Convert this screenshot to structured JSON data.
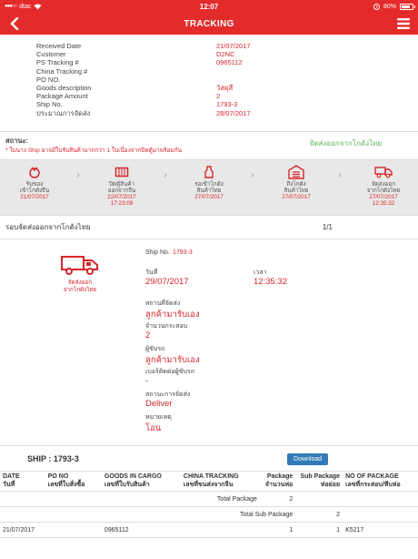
{
  "status_bar": {
    "carrier": "dtac",
    "time": "12:07",
    "battery": "80%",
    "battery_level": 0.8
  },
  "nav": {
    "title": "TRACKING"
  },
  "info": [
    {
      "label": "Received Date",
      "value": "21/07/2017"
    },
    {
      "label": "Customer",
      "value": "D2NC"
    },
    {
      "label": "PS Tracking #",
      "value": "0965112"
    },
    {
      "label": "China Tracking #",
      "value": ""
    },
    {
      "label": "PO NO.",
      "value": ""
    },
    {
      "label": "Goods description",
      "value": "วัสดุสี"
    },
    {
      "label": "Package Amount",
      "value": "2"
    },
    {
      "label": "Ship No.",
      "value": "1793-3"
    },
    {
      "label": "ประมาณการจัดส่ง",
      "value": "28/07/2017"
    }
  ],
  "status": {
    "label": "สถานะ:",
    "note": "* ใบนาง Ship อาจมีใบรับสินค้ามากกว่า 1 ใบเนื่องจากปิดตู้มาพร้อมกัน",
    "state": "จัดส่งออกจากโกดังไทย"
  },
  "timeline": [
    {
      "icon": "receive-icon",
      "title": [
        "รับของ",
        "เข้าโกดังจีน"
      ],
      "date": "21/07/2017",
      "time": ""
    },
    {
      "icon": "container-icon",
      "title": [
        "ปิดตู้สินค้า",
        "ออกจากจีน"
      ],
      "date": "22/07/2017",
      "time": "17:23:09"
    },
    {
      "icon": "bottle-icon",
      "title": [
        "รอเข้าโกดัง",
        "สินค้าไทย"
      ],
      "date": "27/07/2017",
      "time": ""
    },
    {
      "icon": "warehouse-icon",
      "title": [
        "ถึงโกดัง",
        "สินค้าไทย"
      ],
      "date": "27/07/2017",
      "time": ""
    },
    {
      "icon": "truck-icon",
      "title": [
        "จัดส่งออก",
        "จากโกดังไทย"
      ],
      "date": "27/07/2017",
      "time": "12:35:32"
    }
  ],
  "section": {
    "title": "รอบจัดส่งออกจากโกดังไทย",
    "page": "1/1"
  },
  "detail": {
    "truck_label": [
      "จัดส่งออก",
      "จากโกดังไทย"
    ],
    "ship_no_label": "Ship No.",
    "ship_no": "1793-3",
    "date_label": "วันที่",
    "date": "29/07/2017",
    "time_label": "เวลา",
    "time": "12:35:32",
    "place_label": "สถานที่จัดส่ง",
    "place": "ลูกค้ามารับเอง",
    "qty_label": "จำนวนกระสอบ",
    "qty": "2",
    "receiver_label": "ผู้ขับรถ",
    "receiver": "ลูกค้ามารับเอง",
    "phone_label": "เบอร์ติดต่อผู้ขับรถ",
    "phone": "-",
    "ship_status_label": "สถานะการจัดส่ง",
    "ship_status": "Deliver",
    "remark_label": "หมายเหตุ",
    "remark": "โอน"
  },
  "ship": {
    "title": "SHIP : 1793-3",
    "download": "Download"
  },
  "table": {
    "headers": [
      [
        "DATE",
        "วันที่"
      ],
      [
        "PO NO",
        "เลขที่ใบสั่งซื้อ"
      ],
      [
        "GOODS IN CARGO",
        "เลขที่ใบรับสินค้า"
      ],
      [
        "CHINA TRACKING",
        "เลขที่ขนส่งจากจีน"
      ],
      [
        "Package",
        "จำนวนห่อ"
      ],
      [
        "Sub Package",
        "ห่อย่อย"
      ],
      [
        "NO OF PACKAGE",
        "เลขที่กระสอบ/หีบห่อ"
      ]
    ],
    "total_package_label": "Total Package",
    "total_package": "2",
    "total_sub_label": "Total Sub Package",
    "total_sub": "2",
    "rows": [
      [
        "21/07/2017",
        "",
        "0965112",
        "",
        "1",
        "1",
        "K5217"
      ]
    ]
  }
}
